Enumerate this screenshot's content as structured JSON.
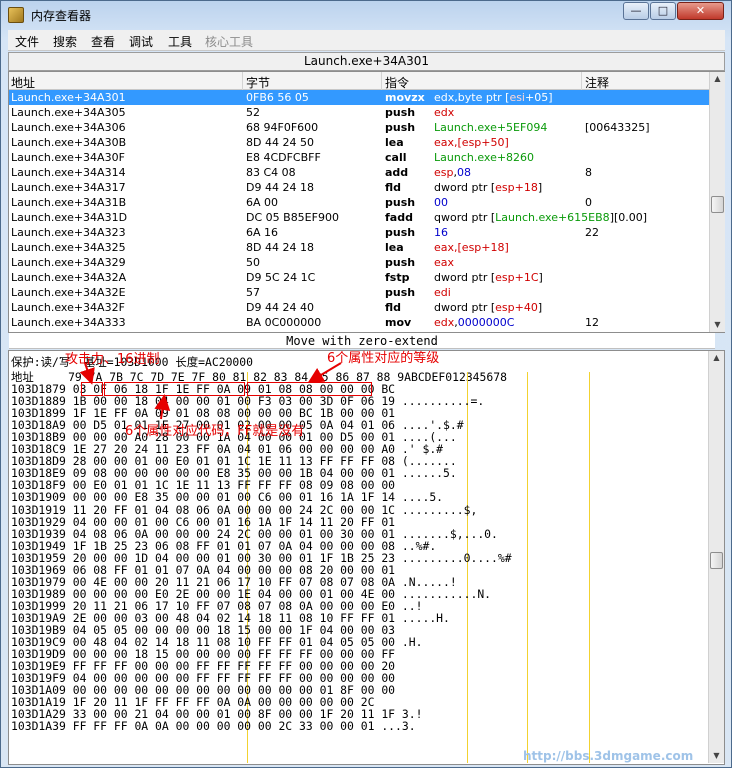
{
  "window": {
    "title": "内存查看器",
    "min": "—",
    "max": "□",
    "close": "✕"
  },
  "menu": {
    "file": "文件",
    "search": "搜索",
    "view": "查看",
    "debug": "调试",
    "tools": "工具",
    "kernel": "核心工具"
  },
  "disasm": {
    "title": "Launch.exe+34A301",
    "headers": {
      "address": "地址",
      "bytes": "字节",
      "opcode": "指令",
      "comment": "注释"
    },
    "rows": [
      {
        "addr": "Launch.exe+34A301",
        "bytes": "0FB6 56 05",
        "op": "movzx",
        "args": [
          [
            "edx",
            ""
          ],
          [
            ",byte ptr [",
            ""
          ],
          [
            "esi",
            "r"
          ],
          [
            "+05]",
            ""
          ]
        ],
        "cmt": ""
      },
      {
        "addr": "Launch.exe+34A305",
        "bytes": "52",
        "op": "push",
        "args": [
          [
            "edx",
            "r"
          ]
        ],
        "cmt": ""
      },
      {
        "addr": "Launch.exe+34A306",
        "bytes": "68 94F0F600",
        "op": "push",
        "args": [
          [
            "Launch.exe+5EF094",
            "g"
          ]
        ],
        "cmt": "[00643325]"
      },
      {
        "addr": "Launch.exe+34A30B",
        "bytes": "8D 44 24 50",
        "op": "lea",
        "args": [
          [
            "eax,[esp+50]",
            "r"
          ]
        ],
        "cmt": ""
      },
      {
        "addr": "Launch.exe+34A30F",
        "bytes": "E8 4CDFCBFF",
        "op": "call",
        "args": [
          [
            "Launch.exe+8260",
            "g"
          ]
        ],
        "cmt": ""
      },
      {
        "addr": "Launch.exe+34A314",
        "bytes": "83 C4 08",
        "op": "add",
        "args": [
          [
            "esp",
            "r"
          ],
          [
            ",",
            ""
          ],
          [
            "08",
            "b"
          ]
        ],
        "cmt": "8"
      },
      {
        "addr": "Launch.exe+34A317",
        "bytes": "D9 44 24 18",
        "op": "fld",
        "args": [
          [
            "dword ptr [",
            ""
          ],
          [
            "esp+18",
            "r"
          ],
          [
            "]",
            ""
          ]
        ],
        "cmt": ""
      },
      {
        "addr": "Launch.exe+34A31B",
        "bytes": "6A 00",
        "op": "push",
        "args": [
          [
            "00",
            "b"
          ]
        ],
        "cmt": "0"
      },
      {
        "addr": "Launch.exe+34A31D",
        "bytes": "DC 05 B85EF900",
        "op": "fadd",
        "args": [
          [
            "qword ptr [",
            ""
          ],
          [
            "Launch.exe+615EB8",
            "g"
          ],
          [
            "][0.00]",
            ""
          ]
        ],
        "cmt": ""
      },
      {
        "addr": "Launch.exe+34A323",
        "bytes": "6A 16",
        "op": "push",
        "args": [
          [
            "16",
            "b"
          ]
        ],
        "cmt": "22"
      },
      {
        "addr": "Launch.exe+34A325",
        "bytes": "8D 44 24 18",
        "op": "lea",
        "args": [
          [
            "eax,[esp+18]",
            "r"
          ]
        ],
        "cmt": ""
      },
      {
        "addr": "Launch.exe+34A329",
        "bytes": "50",
        "op": "push",
        "args": [
          [
            "eax",
            "r"
          ]
        ],
        "cmt": ""
      },
      {
        "addr": "Launch.exe+34A32A",
        "bytes": "D9 5C 24 1C",
        "op": "fstp",
        "args": [
          [
            "dword ptr [",
            ""
          ],
          [
            "esp+1C",
            "r"
          ],
          [
            "]",
            ""
          ]
        ],
        "cmt": ""
      },
      {
        "addr": "Launch.exe+34A32E",
        "bytes": "57",
        "op": "push",
        "args": [
          [
            "edi",
            "r"
          ]
        ],
        "cmt": ""
      },
      {
        "addr": "Launch.exe+34A32F",
        "bytes": "D9 44 24 40",
        "op": "fld",
        "args": [
          [
            "dword ptr [",
            ""
          ],
          [
            "esp+40",
            "r"
          ],
          [
            "]",
            ""
          ]
        ],
        "cmt": ""
      },
      {
        "addr": "Launch.exe+34A333",
        "bytes": "BA 0C000000",
        "op": "mov",
        "args": [
          [
            "edx",
            "r"
          ],
          [
            ",",
            ""
          ],
          [
            "0000000C",
            "b"
          ]
        ],
        "cmt": "12"
      }
    ]
  },
  "description": "Move with zero-extend",
  "hexview": {
    "info": "保护:读/写  基址=103D1000 长度=AC20000",
    "header": "地址     79 7A 7B 7C 7D 7E 7F 80 81 82 83 84 85 86 87 88 9ABCDEF012345678",
    "lines": [
      "103D1879 03 0F 06 18 1F 1E FF 0A 09 01 08 08 00 00 00 BC ",
      "103D1889 1B 00 00 18 04 00 00 01 00 F3 03 00 3D 0F 06 19 ..........=.",
      "103D1899 1F 1E FF 0A 09 01 08 08 00 00 00 BC 1B 00 00 01 ",
      "103D18A9 00 D5 01 01 1E 27 00 01 02 00 00 05 0A 04 01 06 ....'.$.#",
      "103D18B9 00 00 00 A0 28 00 00 1A 04 00 00 01 00 D5 00 01 ....(...",
      "103D18C9 1E 27 20 24 11 23 FF 0A 04 01 06 00 00 00 00 A0 .' $.#",
      "103D18D9 28 00 00 01 00 E0 01 01 1C 1E 11 13 FF FF FF 08 (.......",
      "103D18E9 09 08 00 00 00 00 00 E8 35 00 00 1B 04 00 00 01 ......5.",
      "103D18F9 00 E0 01 01 1C 1E 11 13 FF FF FF 08 09 08 00 00 ",
      "103D1909 00 00 00 E8 35 00 00 01 00 C6 00 01 16 1A 1F 14 ....5.",
      "103D1919 11 20 FF 01 04 08 06 0A 00 00 00 24 2C 00 00 1C .........$,",
      "103D1929 04 00 00 01 00 C6 00 01 16 1A 1F 14 11 20 FF 01 ",
      "103D1939 04 08 06 0A 00 00 00 24 2C 00 00 01 00 30 00 01 .......$,...0.",
      "103D1949 1F 1B 25 23 06 08 FF 01 01 07 0A 04 00 00 00 08 ..%#.",
      "103D1959 20 00 00 1D 04 00 00 01 00 30 00 01 1F 1B 25 23 .........0....%#",
      "103D1969 06 08 FF 01 01 07 0A 04 00 00 00 08 20 00 00 01 ",
      "103D1979 00 4E 00 00 20 11 21 06 17 10 FF 07 08 07 08 0A .N.....!",
      "103D1989 00 00 00 00 E0 2E 00 00 1E 04 00 00 01 00 4E 00 ...........N.",
      "103D1999 20 11 21 06 17 10 FF 07 08 07 08 0A 00 00 00 E0 ..!",
      "103D19A9 2E 00 00 03 00 48 04 02 14 18 11 08 10 FF FF 01 .....H.",
      "103D19B9 04 05 05 00 00 00 00 18 15 00 00 1F 04 00 00 03 ",
      "103D19C9 00 48 04 02 14 18 11 08 10 FF FF 01 04 05 05 00 .H.",
      "103D19D9 00 00 00 18 15 00 00 00 00 FF FF FF 00 00 00 FF ",
      "103D19E9 FF FF FF 00 00 00 FF FF FF FF FF 00 00 00 00 20 ",
      "103D19F9 04 00 00 00 00 00 FF FF FF FF FF 00 00 00 00 00 ",
      "103D1A09 00 00 00 00 00 00 00 00 00 00 00 00 01 8F 00 00 ",
      "103D1A19 1F 20 11 1F FF FF FF 0A 0A 00 00 00 00 00 2C ",
      "103D1A29 33 00 00 21 04 00 00 01 00 8F 00 00 1F 20 11 1F 3.!",
      "103D1A39 FF FF FF 0A 0A 00 00 00 00 00 2C 33 00 00 01 ...3."
    ]
  },
  "annotations": {
    "attack": "攻击力、16进制",
    "levels": "6个属性对应的等级",
    "codes": "6个属性对应代码，FF就是没有"
  },
  "watermark": "http://bbs.3dmgame.com"
}
